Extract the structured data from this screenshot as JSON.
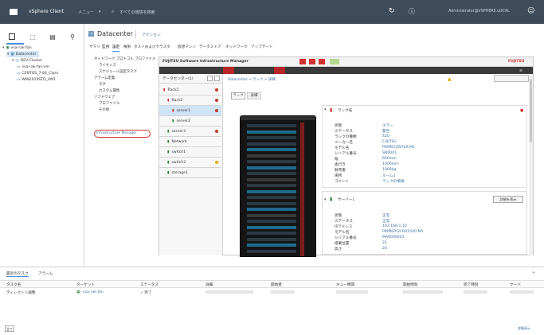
{
  "app": {
    "name": "vSphere Client",
    "menu": "メニュー",
    "search": "すべての環境を検索",
    "user": "Administrator@VSPHERE.LOCAL"
  },
  "left_tree": {
    "items": [
      {
        "label": "vsa-rak-fan"
      },
      {
        "label": "Datacenter",
        "selected": true
      },
      {
        "label": "DEV-Cluster"
      },
      {
        "label": "vsa-rak-fan-vm"
      },
      {
        "label": "CENTOS_7-64_Class"
      },
      {
        "label": "WIN2019STD_VM1"
      }
    ]
  },
  "center": {
    "title": "Datacenter",
    "actions": "アクション",
    "tabs": [
      "サマリ",
      "監視",
      "設定",
      "権限",
      "ホストおよびクラスタ",
      "仮想マシン",
      "データストア",
      "ネットワーク",
      "アップデート"
    ]
  },
  "config_menu": {
    "items": [
      {
        "label": "ネットワーク プロトコル プロファイル"
      },
      {
        "label": "ライセンス"
      },
      {
        "label": "スケジュール設定タスク"
      },
      {
        "label": "アラーム定義"
      },
      {
        "label": "タグ"
      },
      {
        "label": "カスタム属性"
      },
      {
        "label": "ソフトウェア"
      },
      {
        "label": "プロファイル"
      },
      {
        "label": "その他"
      },
      {
        "label": "Infrastructure Manager",
        "highlighted": true
      }
    ]
  },
  "plugin": {
    "title": "FUJITSU Software Infrastructure Manager",
    "brand": "FUJITSU",
    "tree_header": "データセンター(1)",
    "list": [
      {
        "label": "Rack1"
      },
      {
        "label": "Rack2"
      },
      {
        "label": "server1"
      },
      {
        "label": "server2"
      },
      {
        "label": "server3"
      },
      {
        "label": "Network"
      },
      {
        "label": "switch1"
      },
      {
        "label": "switch2"
      },
      {
        "label": "storage1"
      }
    ],
    "tabs": [
      "ラック",
      "詳細"
    ],
    "breadcrumb": "Datacenter > ラック > 詳細",
    "box1": {
      "title": "ラック名",
      "rows": [
        {
          "k": "状態",
          "v": "エラー"
        },
        {
          "k": "ステータス",
          "v": "警告"
        },
        {
          "k": "ラックの種類",
          "v": "42U"
        },
        {
          "k": "メーカー名",
          "v": "FUJITSU"
        },
        {
          "k": "モデル名",
          "v": "PRIMECENTER M1"
        },
        {
          "k": "シリアル番号",
          "v": "SN0001"
        },
        {
          "k": "幅",
          "v": "600mm"
        },
        {
          "k": "奥行き",
          "v": "1000mm"
        },
        {
          "k": "耐荷重",
          "v": "1000kg"
        },
        {
          "k": "場所",
          "v": "ルーム1"
        },
        {
          "k": "コメント",
          "v": "ラックの情報"
        }
      ]
    },
    "box2": {
      "title": "サーバー1",
      "action": "詳細を表示",
      "rows": [
        {
          "k": "状態",
          "v": "正常"
        },
        {
          "k": "ステータス",
          "v": "正常"
        },
        {
          "k": "IPアドレス",
          "v": "192.168.1.10"
        },
        {
          "k": "モデル名",
          "v": "PRIMERGY RX2540 M5"
        },
        {
          "k": "シリアル番号",
          "v": "MA0000001"
        },
        {
          "k": "搭載位置",
          "v": "22"
        },
        {
          "k": "高さ",
          "v": "2U"
        }
      ]
    }
  },
  "bottom": {
    "tabs": [
      "最近のタスク",
      "アラーム"
    ],
    "columns": [
      "タスク名",
      "ターゲット",
      "ステータス",
      "詳細",
      "開始者",
      "キュー時間",
      "開始時刻",
      "完了時刻",
      "サーバ"
    ],
    "rows": [
      {
        "task": "ディレクトリ調整",
        "target": "vsa-rak-fan",
        "status": "✓ 完了",
        "detail": "",
        "initiator": "",
        "queue": "",
        "start": "",
        "finish": "",
        "server": ""
      }
    ],
    "footer": "全て",
    "more": "詳細表示"
  }
}
